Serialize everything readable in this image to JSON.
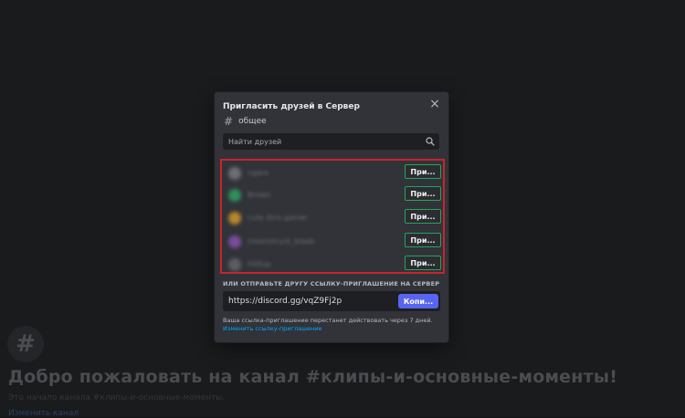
{
  "background": {
    "hash": "#",
    "title": "Добро пожаловать на канал #клипы-и-основные-моменты!",
    "subtitle": "Это начало канала #клипы-и-основные-моменты.",
    "link": "Изменить канал"
  },
  "modal": {
    "title": "Пригласить друзей в Сервер",
    "close_icon": "×",
    "channel_icon": "#",
    "channel_name": "общее",
    "search_placeholder": "Найти друзей",
    "friends": [
      {
        "name": "ngaro",
        "avatar_color": "#6d6f75",
        "invite_label": "При..."
      },
      {
        "name": "Brown",
        "avatar_color": "#2f8f5a",
        "invite_label": "При..."
      },
      {
        "name": "cute dino gamer",
        "avatar_color": "#b8862c",
        "invite_label": "При..."
      },
      {
        "name": "moonstruck_blade",
        "avatar_color": "#7a4d9a",
        "invite_label": "При..."
      },
      {
        "name": "Hilltop",
        "avatar_color": "#5b5e64",
        "invite_label": "При..."
      }
    ],
    "invite_link_label": "ИЛИ ОТПРАВЬТЕ ДРУГУ ССЫЛКУ-ПРИГЛАШЕНИЕ НА СЕРВЕР",
    "invite_link": "https://discord.gg/vqZ9Fj2p",
    "copy_label": "Копи...",
    "expiry_text": "Ваша ссылка-приглашение перестанет действовать через 7 дней.",
    "edit_link_text": "Изменить ссылку-приглашение"
  },
  "colors": {
    "accent": "#5865f2",
    "invite_border": "#23a55a",
    "highlight_border": "#c9232e",
    "link": "#00a8fc"
  }
}
